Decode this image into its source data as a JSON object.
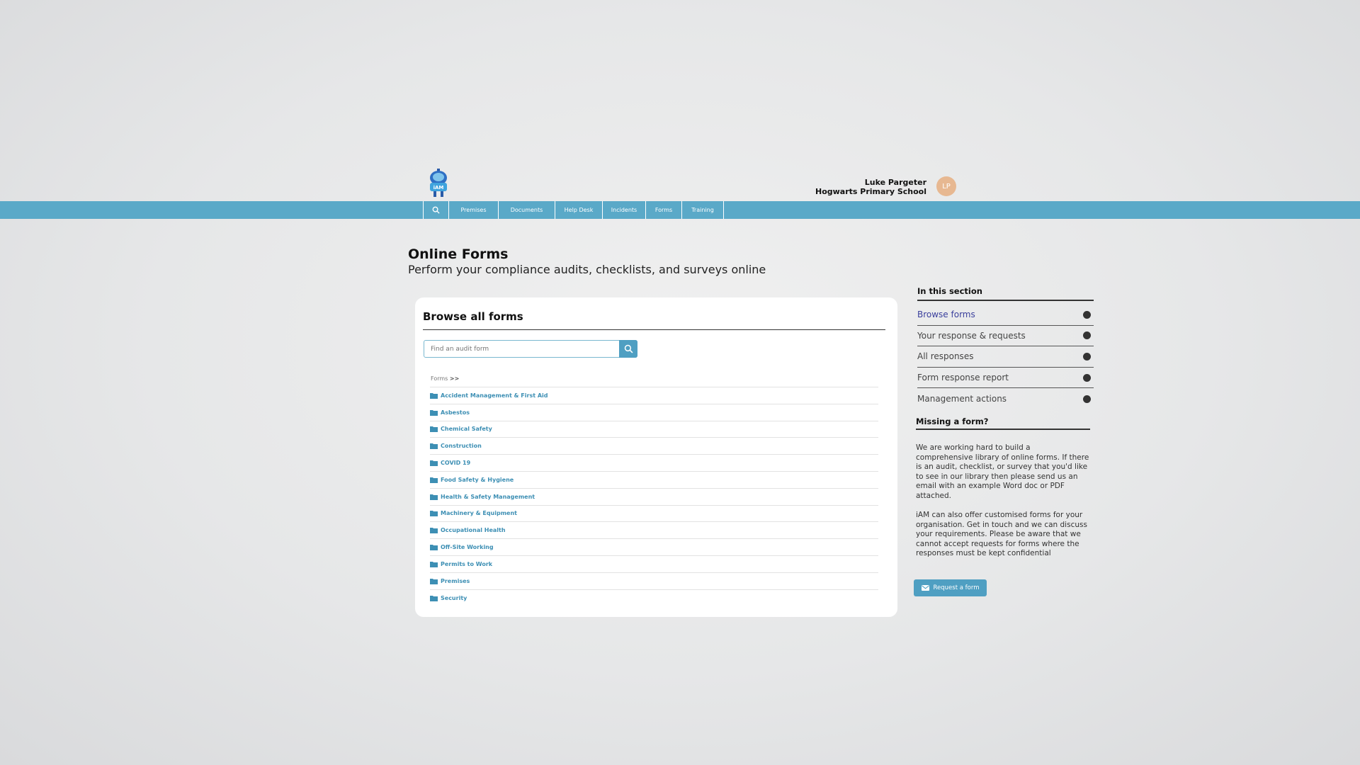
{
  "header": {
    "user_name": "Luke Pargeter",
    "school": "Hogwarts Primary School",
    "avatar_initials": "LP",
    "logo_text": "iAM"
  },
  "nav": {
    "items": [
      "Premises",
      "Documents",
      "Help Desk",
      "Incidents",
      "Forms",
      "Training"
    ]
  },
  "page": {
    "title": "Online Forms",
    "subtitle": "Perform your compliance audits, checklists, and surveys online"
  },
  "browse": {
    "title": "Browse all forms",
    "search_placeholder": "Find an audit form",
    "breadcrumb": "Forms",
    "breadcrumb_sep": ">>",
    "folders": [
      "Accident Management & First Aid",
      "Asbestos",
      "Chemical Safety",
      "Construction",
      "COVID 19",
      "Food Safety & Hygiene",
      "Health & Safety Management",
      "Machinery & Equipment",
      "Occupational Health",
      "Off-Site Working",
      "Permits to Work",
      "Premises",
      "Security"
    ]
  },
  "sidebar": {
    "heading": "In this section",
    "items": [
      "Browse forms",
      "Your response & requests",
      "All responses",
      "Form response report",
      "Management actions"
    ],
    "missing_heading": "Missing a form?",
    "paragraph1": "We are working hard to build a comprehensive library of online forms. If there is an audit, checklist, or survey that you'd like to see in our library then please send us an email with an example Word doc or PDF attached.",
    "paragraph2": "iAM can also offer customised forms for your organisation. Get in touch and we can discuss your requirements. Please be aware that we cannot accept requests for forms where the responses must be kept confidential",
    "request_button": "Request a form"
  },
  "colors": {
    "nav_bar": "#5aa9c8",
    "link": "#3d8fb4",
    "active_side": "#3a3f9c",
    "button": "#4f9fc2"
  }
}
